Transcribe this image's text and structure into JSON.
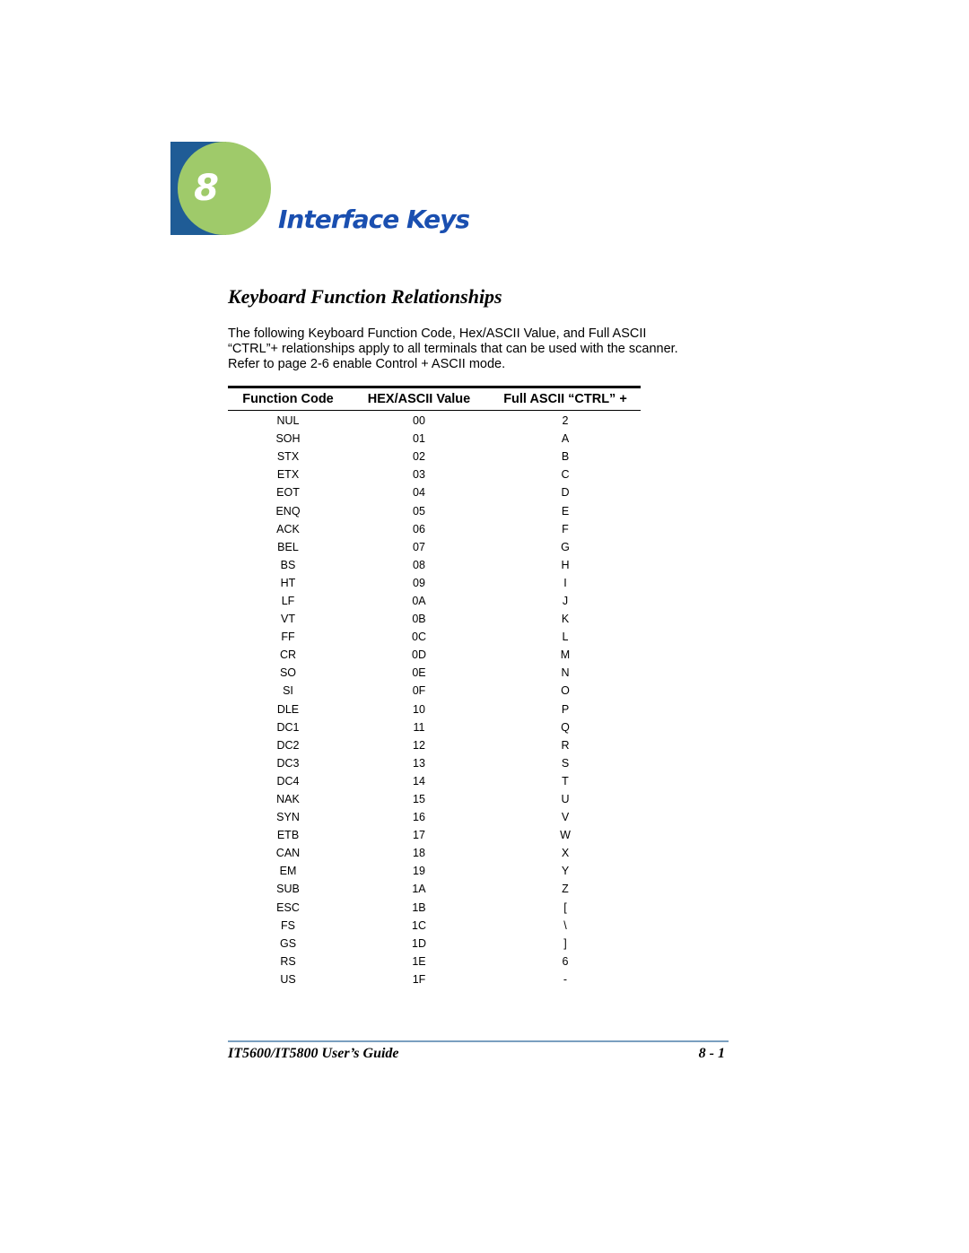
{
  "chapter": {
    "number": "8",
    "title": "Interface Keys"
  },
  "section": {
    "title": "Keyboard Function Relationships"
  },
  "intro": {
    "lines": [
      "The following Keyboard Function Code, Hex/ASCII Value, and Full ASCII",
      "“CTRL”+  relationships apply to all terminals that can be used with the scanner.",
      "Refer to page 2-6 enable Control + ASCII mode."
    ]
  },
  "table": {
    "headers": [
      "Function Code",
      "HEX/ASCII Value",
      "Full ASCII “CTRL” +"
    ],
    "rows": [
      [
        "NUL",
        "00",
        "2"
      ],
      [
        "SOH",
        "01",
        "A"
      ],
      [
        "STX",
        "02",
        "B"
      ],
      [
        "ETX",
        "03",
        "C"
      ],
      [
        "EOT",
        "04",
        "D"
      ],
      [
        "ENQ",
        "05",
        "E"
      ],
      [
        "ACK",
        "06",
        "F"
      ],
      [
        "BEL",
        "07",
        "G"
      ],
      [
        "BS",
        "08",
        "H"
      ],
      [
        "HT",
        "09",
        "I"
      ],
      [
        "LF",
        "0A",
        "J"
      ],
      [
        "VT",
        "0B",
        "K"
      ],
      [
        "FF",
        "0C",
        "L"
      ],
      [
        "CR",
        "0D",
        "M"
      ],
      [
        "SO",
        "0E",
        "N"
      ],
      [
        "SI",
        "0F",
        "O"
      ],
      [
        "DLE",
        "10",
        "P"
      ],
      [
        "DC1",
        "11",
        "Q"
      ],
      [
        "DC2",
        "12",
        "R"
      ],
      [
        "DC3",
        "13",
        "S"
      ],
      [
        "DC4",
        "14",
        "T"
      ],
      [
        "NAK",
        "15",
        "U"
      ],
      [
        "SYN",
        "16",
        "V"
      ],
      [
        "ETB",
        "17",
        "W"
      ],
      [
        "CAN",
        "18",
        "X"
      ],
      [
        "EM",
        "19",
        "Y"
      ],
      [
        "SUB",
        "1A",
        "Z"
      ],
      [
        "ESC",
        "1B",
        "["
      ],
      [
        "FS",
        "1C",
        "\\"
      ],
      [
        "GS",
        "1D",
        "]"
      ],
      [
        "RS",
        "1E",
        "6"
      ],
      [
        "US",
        "1F",
        "-"
      ]
    ]
  },
  "footer": {
    "title": "IT5600/IT5800 User’s Guide",
    "page": "8 - 1"
  }
}
